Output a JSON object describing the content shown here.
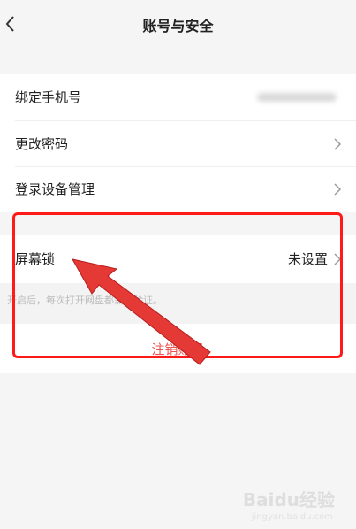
{
  "header": {
    "title": "账号与安全",
    "back_icon": "chevron-left-icon"
  },
  "rows": {
    "bind_phone": {
      "label": "绑定手机号"
    },
    "change_password": {
      "label": "更改密码"
    },
    "device_management": {
      "label": "登录设备管理"
    },
    "screen_lock": {
      "label": "屏幕锁",
      "value": "未设置"
    }
  },
  "screen_lock_hint": "开启后，每次打开网盘都需要验证。",
  "logout_label": "注销账号",
  "watermark": {
    "brand": "Baidu经验",
    "sub": "jingyan.baidu.com"
  },
  "colors": {
    "highlight": "#ff1a1a",
    "logout_text": "#ef5350",
    "arrow": "#e53935"
  }
}
